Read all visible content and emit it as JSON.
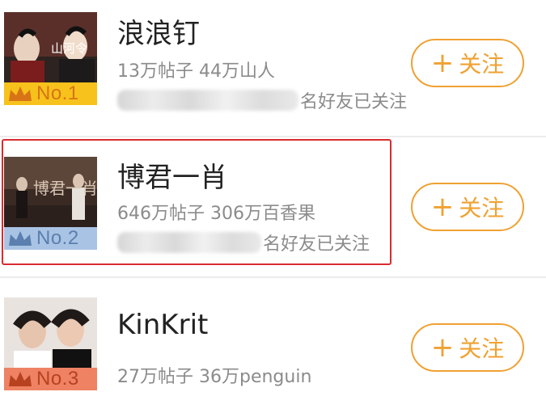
{
  "topics": [
    {
      "title": "浪浪钉",
      "stats": "13万帖子 44万山人",
      "friends_suffix": "名好友已关注",
      "rank": "No.1",
      "follow_label": "关注",
      "badge_color": "#f7c21b",
      "badge_text_color": "#ffffff",
      "thumb_caption": "山河令",
      "thumb_colors": [
        "#2d2320",
        "#7b1d1d",
        "#e9ddd2"
      ]
    },
    {
      "title": "博君一肖",
      "stats": "646万帖子 306万百香果",
      "friends_suffix": "名好友已关注",
      "rank": "No.2",
      "follow_label": "关注",
      "badge_color": "#a9c3e4",
      "badge_text_color": "#ffffff",
      "thumb_caption": "博君一肖",
      "thumb_colors": [
        "#3a2a24",
        "#8c6a55",
        "#cdb7a3"
      ]
    },
    {
      "title": "KinKrit",
      "stats": "27万帖子 36万penguin",
      "rank": "No.3",
      "follow_label": "关注",
      "badge_color": "#ee8263",
      "badge_text_color": "#ffffff",
      "thumb_colors": [
        "#e9e3df",
        "#1f1a18",
        "#ffffff"
      ]
    }
  ],
  "colors": {
    "accent": "#f0a132",
    "highlight": "#d92b30",
    "title_text": "#222222",
    "meta_text": "#8b8b8b"
  }
}
